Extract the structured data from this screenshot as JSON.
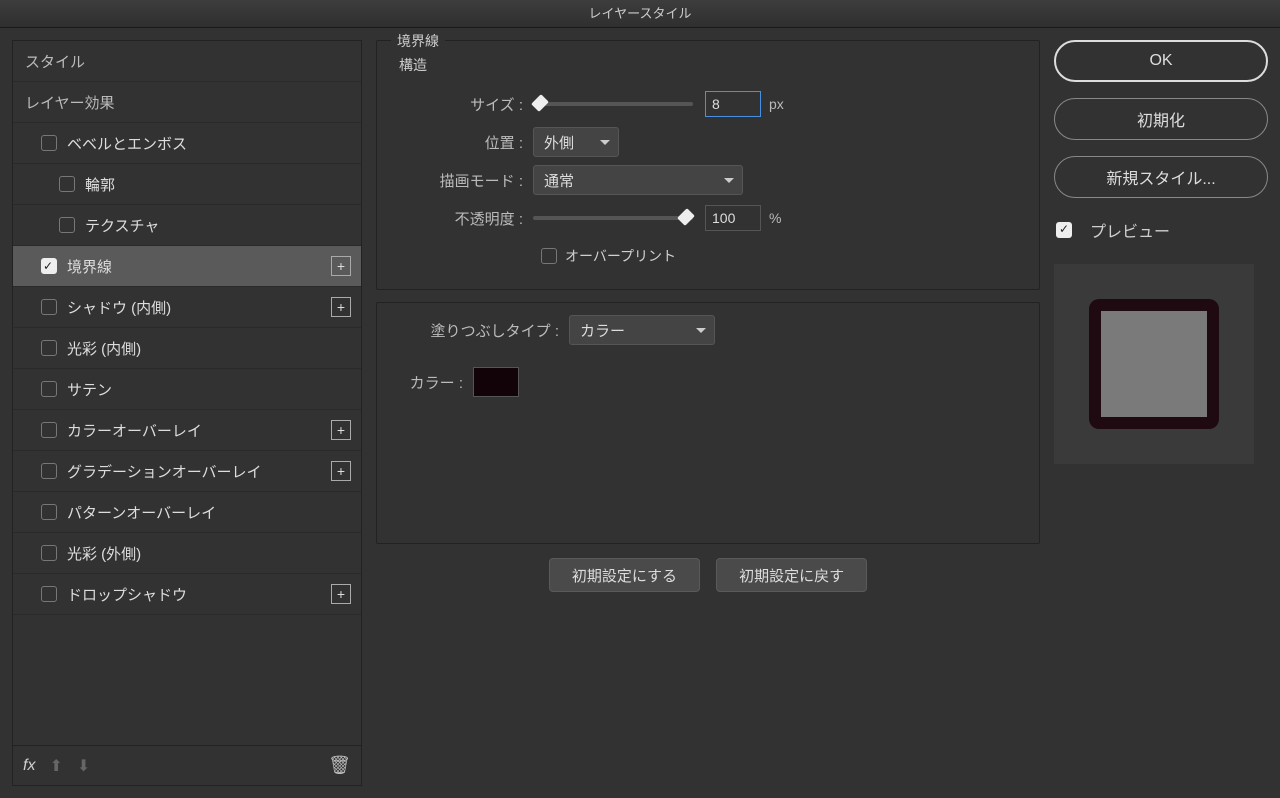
{
  "title": "レイヤースタイル",
  "sidebar": {
    "styles_header": "スタイル",
    "effects_header": "レイヤー効果",
    "items": [
      {
        "label": "ベベルとエンボス",
        "indent": 1,
        "checkbox": true,
        "plus": false
      },
      {
        "label": "輪郭",
        "indent": 2,
        "checkbox": true,
        "plus": false
      },
      {
        "label": "テクスチャ",
        "indent": 2,
        "checkbox": true,
        "plus": false
      },
      {
        "label": "境界線",
        "indent": 1,
        "checkbox": true,
        "plus": true,
        "selected": true
      },
      {
        "label": "シャドウ (内側)",
        "indent": 1,
        "checkbox": true,
        "plus": true
      },
      {
        "label": "光彩 (内側)",
        "indent": 1,
        "checkbox": true,
        "plus": false
      },
      {
        "label": "サテン",
        "indent": 1,
        "checkbox": true,
        "plus": false
      },
      {
        "label": "カラーオーバーレイ",
        "indent": 1,
        "checkbox": true,
        "plus": true
      },
      {
        "label": "グラデーションオーバーレイ",
        "indent": 1,
        "checkbox": true,
        "plus": true
      },
      {
        "label": "パターンオーバーレイ",
        "indent": 1,
        "checkbox": true,
        "plus": false
      },
      {
        "label": "光彩 (外側)",
        "indent": 1,
        "checkbox": true,
        "plus": false
      },
      {
        "label": "ドロップシャドウ",
        "indent": 1,
        "checkbox": true,
        "plus": true
      }
    ],
    "footer": {
      "fx": "fx"
    }
  },
  "center": {
    "group_title": "境界線",
    "sub_title": "構造",
    "size_label": "サイズ :",
    "size_value": "8",
    "size_unit": "px",
    "position_label": "位置 :",
    "position_value": "外側",
    "blend_label": "描画モード :",
    "blend_value": "通常",
    "opacity_label": "不透明度 :",
    "opacity_value": "100",
    "opacity_unit": "%",
    "overprint_label": "オーバープリント",
    "filltype_label": "塗りつぶしタイプ :",
    "filltype_value": "カラー",
    "color_label": "カラー :",
    "make_default": "初期設定にする",
    "reset_default": "初期設定に戻す"
  },
  "right": {
    "ok": "OK",
    "reset": "初期化",
    "new_style": "新規スタイル...",
    "preview": "プレビュー"
  }
}
